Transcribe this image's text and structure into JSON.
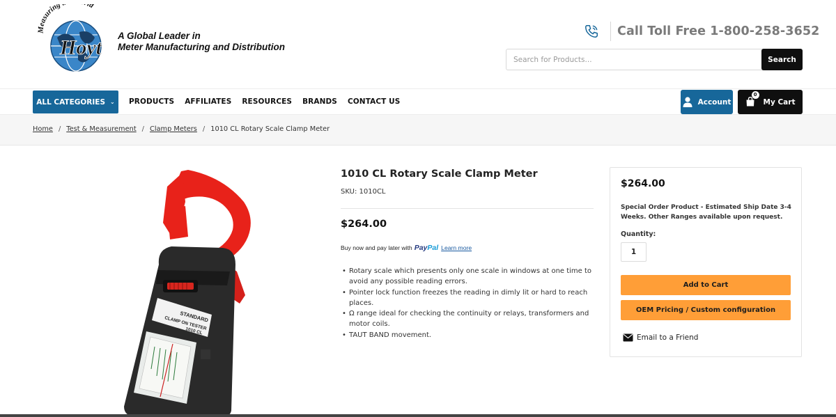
{
  "header": {
    "logo_text": "Measuring the World",
    "logo_brand": "Hoyt",
    "tagline_line1": "A Global Leader in",
    "tagline_line2": "Meter Manufacturing and Distribution",
    "phone_text": "Call Toll Free 1-800-258-3652",
    "search_placeholder": "Search for Products...",
    "search_button": "Search"
  },
  "nav": {
    "all_categories": "ALL CATEGORIES",
    "links": [
      "PRODUCTS",
      "AFFILIATES",
      "RESOURCES",
      "BRANDS",
      "CONTACT US"
    ],
    "account": "Account",
    "cart": "My Cart",
    "cart_count": "0"
  },
  "breadcrumb": [
    "Home",
    "Test & Measurement",
    "Clamp Meters",
    "1010 CL Rotary Scale Clamp Meter"
  ],
  "product": {
    "title": "1010 CL Rotary Scale Clamp Meter",
    "sku": "SKU: 1010CL",
    "price": "$264.00",
    "paypal_prefix": "Buy now and pay later with",
    "paypal_pay": "Pay",
    "paypal_pal": "Pal",
    "paypal_learn": "Learn more",
    "features": [
      "Rotary scale which presents only one scale in windows at one time to avoid any possible reading errors.",
      "Pointer lock function freezes the reading in dimly lit or hard to reach places.",
      "Ω range ideal for checking the continuity or relays, transformers and motor coils.",
      "TAUT BAND movement."
    ],
    "image_label_1": "STANDARD",
    "image_label_2": "CLAMP ON TESTER",
    "image_label_3": "1010 CL"
  },
  "buy_box": {
    "price": "$264.00",
    "note": "Special Order Product - Estimated Ship Date 3-4 Weeks. Other Ranges available upon request.",
    "quantity_label": "Quantity:",
    "quantity_value": "1",
    "add_to_cart": "Add to Cart",
    "oem_pricing": "OEM Pricing / Custom configuration",
    "email_friend": "Email to a Friend"
  },
  "colors": {
    "brand_blue": "#17679a",
    "button_orange": "#ff9e37",
    "dark": "#0f0f0f"
  }
}
